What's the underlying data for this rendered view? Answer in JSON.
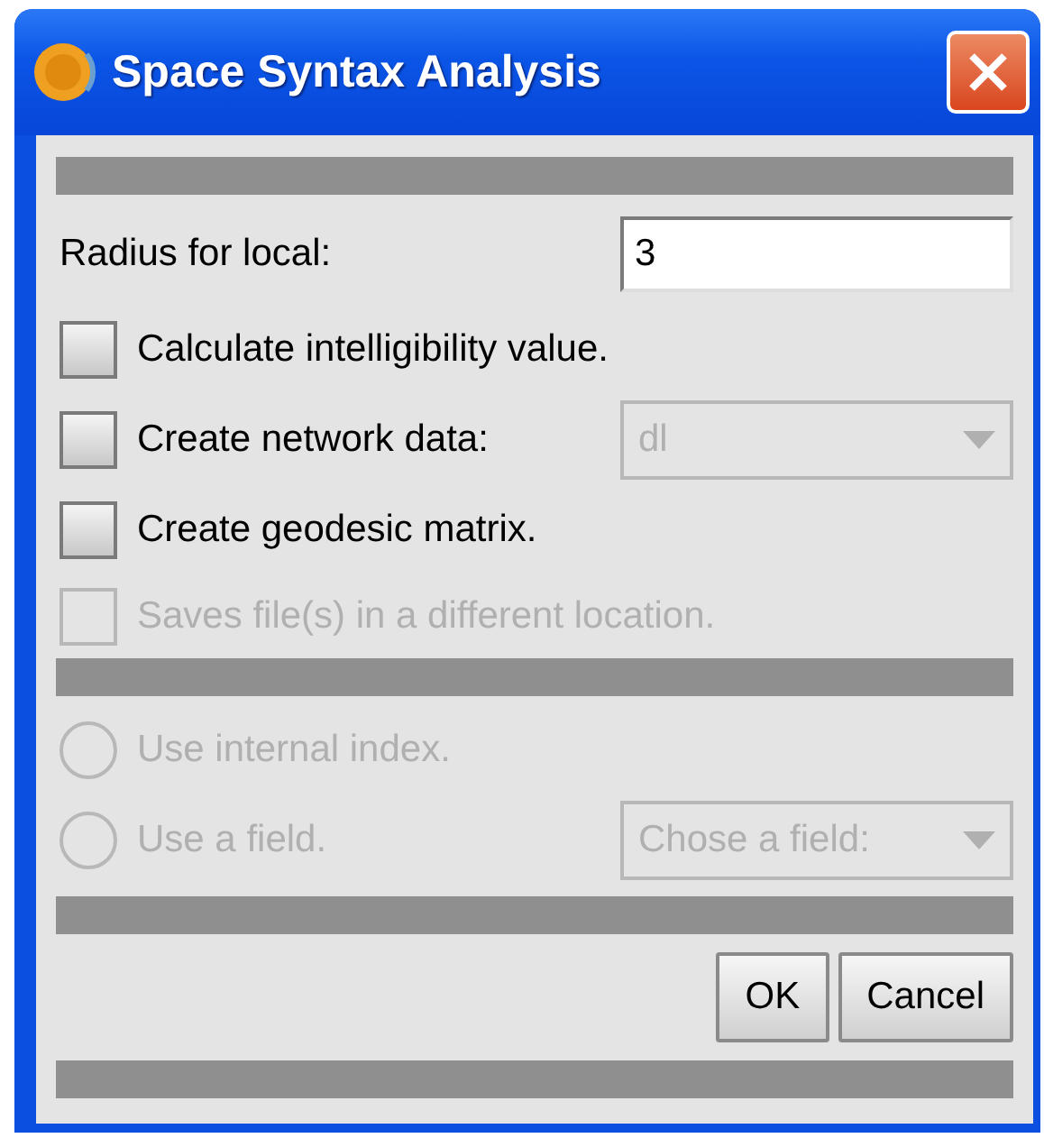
{
  "window": {
    "title": "Space Syntax Analysis"
  },
  "radius": {
    "label": "Radius for local:",
    "value": "3"
  },
  "options": [
    {
      "kind": "checkbox",
      "label": "Calculate intelligibility value.",
      "checked": false,
      "disabled": false
    },
    {
      "kind": "checkbox-combo",
      "label": "Create network data:",
      "checked": false,
      "disabled": false,
      "combo": {
        "value": "dl",
        "disabled": true
      }
    },
    {
      "kind": "checkbox",
      "label": "Create geodesic matrix.",
      "checked": false,
      "disabled": false
    },
    {
      "kind": "checkbox",
      "label": "Saves file(s) in a different location.",
      "checked": false,
      "disabled": true
    }
  ],
  "index_options": [
    {
      "kind": "radio",
      "label": "Use internal index.",
      "selected": false,
      "disabled": true
    },
    {
      "kind": "radio-combo",
      "label": "Use a field.",
      "selected": false,
      "disabled": true,
      "combo": {
        "value": "Chose a field:",
        "disabled": true
      }
    }
  ],
  "buttons": [
    "OK",
    "Cancel"
  ]
}
